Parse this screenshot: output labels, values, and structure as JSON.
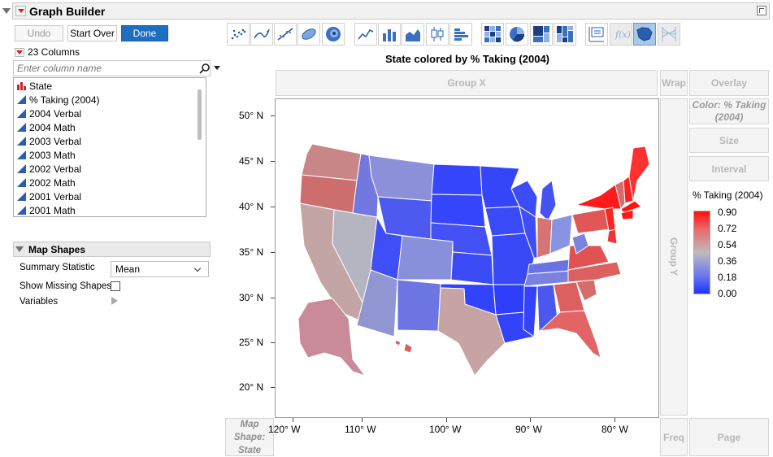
{
  "app": {
    "title": "Graph Builder"
  },
  "actions": {
    "undo": "Undo",
    "start_over": "Start Over",
    "done": "Done"
  },
  "columns": {
    "count_label": "23 Columns",
    "search_placeholder": "Enter column name",
    "items": [
      "State",
      "% Taking (2004)",
      "2004 Verbal",
      "2004 Math",
      "2003 Verbal",
      "2003 Math",
      "2002 Verbal",
      "2002 Math",
      "2001 Verbal",
      "2001 Math"
    ]
  },
  "map_shapes": {
    "title": "Map Shapes",
    "summary_label": "Summary Statistic",
    "summary_value": "Mean",
    "missing_label": "Show Missing Shapes",
    "variables_label": "Variables"
  },
  "zones": {
    "group_x": "Group X",
    "wrap": "Wrap",
    "overlay": "Overlay",
    "color": "Color: % Taking (2004)",
    "size": "Size",
    "interval": "Interval",
    "group_y": "Group Y",
    "map_shape": "Map Shape: State",
    "freq": "Freq",
    "page": "Page"
  },
  "graph": {
    "title": "State colored by % Taking (2004)",
    "y_ticks": [
      "50° N",
      "45° N",
      "40° N",
      "35° N",
      "30° N",
      "25° N",
      "20° N"
    ],
    "x_ticks": [
      "120° W",
      "110° W",
      "100° W",
      "90° W",
      "80° W"
    ]
  },
  "legend": {
    "title": "% Taking (2004)",
    "labels": [
      "0.90",
      "0.72",
      "0.54",
      "0.36",
      "0.18",
      "0.00"
    ],
    "colors": {
      "high": "#ff0f0f",
      "mid": "#bcbcbc",
      "low": "#1f34ff"
    }
  },
  "toolbar": {
    "icons": [
      "points-icon",
      "smoother-icon",
      "line-of-fit-icon",
      "ellipse-icon",
      "contour-icon",
      "line-icon",
      "bar-icon",
      "area-icon",
      "box-plot-icon",
      "histogram-icon",
      "heatmap-icon",
      "pie-icon",
      "treemap-icon",
      "mosaic-icon",
      "caption-box-icon",
      "formula-icon",
      "map-shapes-icon",
      "parallel-plot-icon"
    ]
  }
}
